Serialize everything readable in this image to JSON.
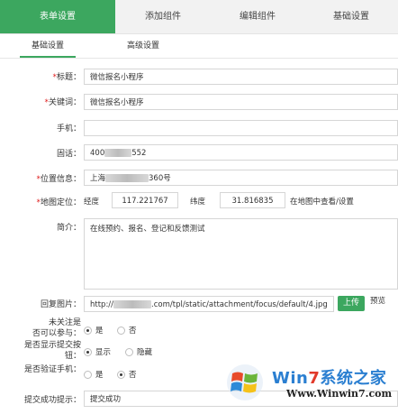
{
  "top_tabs": [
    {
      "label": "表单设置",
      "active": true
    },
    {
      "label": "添加组件",
      "active": false
    },
    {
      "label": "编辑组件",
      "active": false
    },
    {
      "label": "基础设置",
      "active": false
    }
  ],
  "sub_tabs": [
    {
      "label": "基础设置",
      "active": true
    },
    {
      "label": "高级设置",
      "active": false
    }
  ],
  "form": {
    "title": {
      "required": "*",
      "label": "标题：",
      "value": "微信报名小程序"
    },
    "keywords": {
      "required": "*",
      "label": "关键词：",
      "value": "微信报名小程序"
    },
    "mobile": {
      "label": "手机：",
      "value": ""
    },
    "phone": {
      "label": "固话：",
      "value_prefix": "400",
      "value_suffix": "552"
    },
    "location": {
      "required": "*",
      "label": "位置信息：",
      "value_prefix": "上海",
      "value_suffix": "360号"
    },
    "map": {
      "required": "*",
      "label": "地图定位：",
      "lng_label": "经度",
      "lng_value": "117.221767",
      "lat_label": "纬度",
      "lat_value": "31.816835",
      "map_link": "在地图中查看/设置"
    },
    "intro": {
      "label": "简介：",
      "value": "在线预约、报名、登记和反馈测试"
    },
    "reply_image": {
      "label": "回复图片：",
      "url_prefix": "http://",
      "url_suffix": ".com/tpl/static/attachment/focus/default/4.jpg",
      "upload_label": "上传",
      "preview_label": "预览"
    },
    "unfollowed": {
      "label_line1": "未关注是",
      "label_line2": "否可以参与：",
      "opt_yes": "是",
      "opt_no": "否",
      "selected": "是"
    },
    "show_submit": {
      "label_line1": "是否显示提交按",
      "label_line2": "钮：",
      "opt_show": "显示",
      "opt_hide": "隐藏",
      "selected": "显示"
    },
    "verify_phone": {
      "label": "是否验证手机：",
      "opt_yes": "是",
      "opt_no": "否",
      "selected": "否"
    },
    "success_tip": {
      "label": "提交成功提示：",
      "value": "提交成功"
    }
  },
  "watermark": {
    "brand_prefix": "Win",
    "brand_seven": "7",
    "brand_suffix": "系统之家",
    "url": "Www.Winwin7.com"
  },
  "colors": {
    "accent": "#3ca75f",
    "required": "#e02020"
  }
}
